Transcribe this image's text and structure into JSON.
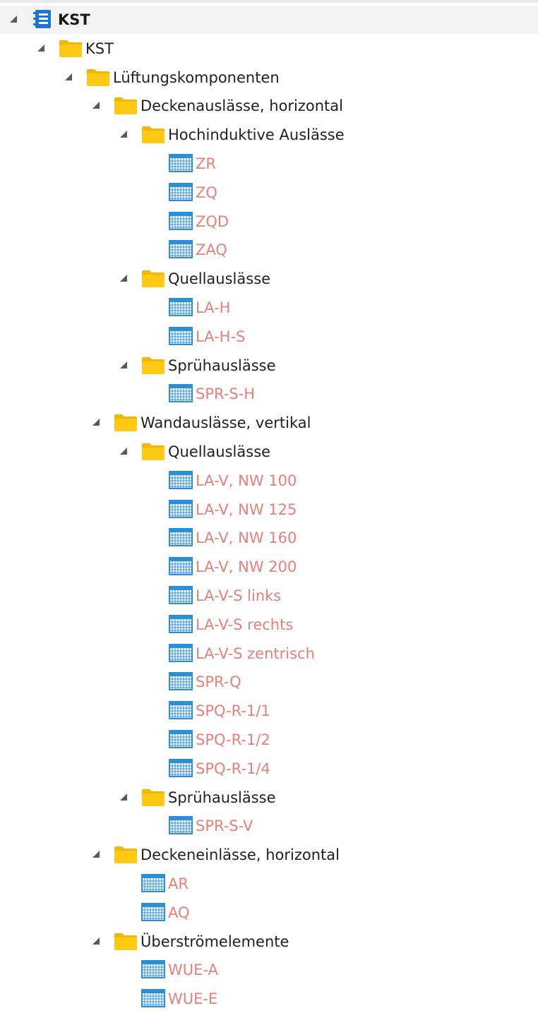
{
  "colors": {
    "folder": "#ffc914",
    "folder_tab": "#f5b800",
    "table_icon": "#2b8fd6",
    "table_text": "#e8807a",
    "root_icon": "#1d74d1"
  },
  "tree": [
    {
      "label": "KST",
      "type": "root",
      "level": 0,
      "expanded": true
    },
    {
      "label": "KST",
      "type": "folder",
      "level": 1,
      "expanded": true
    },
    {
      "label": "Lüftungskomponenten",
      "type": "folder",
      "level": 2,
      "expanded": true
    },
    {
      "label": "Deckenauslässe, horizontal",
      "type": "folder",
      "level": 3,
      "expanded": true
    },
    {
      "label": "Hochinduktive Auslässe",
      "type": "folder",
      "level": 4,
      "expanded": true
    },
    {
      "label": "ZR",
      "type": "table",
      "level": 5
    },
    {
      "label": "ZQ",
      "type": "table",
      "level": 5
    },
    {
      "label": "ZQD",
      "type": "table",
      "level": 5
    },
    {
      "label": "ZAQ",
      "type": "table",
      "level": 5
    },
    {
      "label": "Quellauslässe",
      "type": "folder",
      "level": 4,
      "expanded": true
    },
    {
      "label": "LA-H",
      "type": "table",
      "level": 5
    },
    {
      "label": "LA-H-S",
      "type": "table",
      "level": 5
    },
    {
      "label": "Sprühauslässe",
      "type": "folder",
      "level": 4,
      "expanded": true
    },
    {
      "label": "SPR-S-H",
      "type": "table",
      "level": 5
    },
    {
      "label": "Wandauslässe, vertikal",
      "type": "folder",
      "level": 3,
      "expanded": true
    },
    {
      "label": "Quellauslässe",
      "type": "folder",
      "level": 4,
      "expanded": true
    },
    {
      "label": "LA-V, NW 100",
      "type": "table",
      "level": 5
    },
    {
      "label": "LA-V, NW 125",
      "type": "table",
      "level": 5
    },
    {
      "label": "LA-V, NW 160",
      "type": "table",
      "level": 5
    },
    {
      "label": "LA-V, NW 200",
      "type": "table",
      "level": 5
    },
    {
      "label": "LA-V-S links",
      "type": "table",
      "level": 5
    },
    {
      "label": "LA-V-S rechts",
      "type": "table",
      "level": 5
    },
    {
      "label": "LA-V-S zentrisch",
      "type": "table",
      "level": 5
    },
    {
      "label": "SPR-Q",
      "type": "table",
      "level": 5
    },
    {
      "label": "SPQ-R-1/1",
      "type": "table",
      "level": 5
    },
    {
      "label": "SPQ-R-1/2",
      "type": "table",
      "level": 5
    },
    {
      "label": "SPQ-R-1/4",
      "type": "table",
      "level": 5
    },
    {
      "label": "Sprühauslässe",
      "type": "folder",
      "level": 4,
      "expanded": true
    },
    {
      "label": "SPR-S-V",
      "type": "table",
      "level": 5
    },
    {
      "label": "Deckeneinlässe, horizontal",
      "type": "folder",
      "level": 3,
      "expanded": true
    },
    {
      "label": "AR",
      "type": "table",
      "level": 4
    },
    {
      "label": "AQ",
      "type": "table",
      "level": 4
    },
    {
      "label": "Überströmelemente",
      "type": "folder",
      "level": 3,
      "expanded": true
    },
    {
      "label": "WUE-A",
      "type": "table",
      "level": 4
    },
    {
      "label": "WUE-E",
      "type": "table",
      "level": 4
    }
  ]
}
